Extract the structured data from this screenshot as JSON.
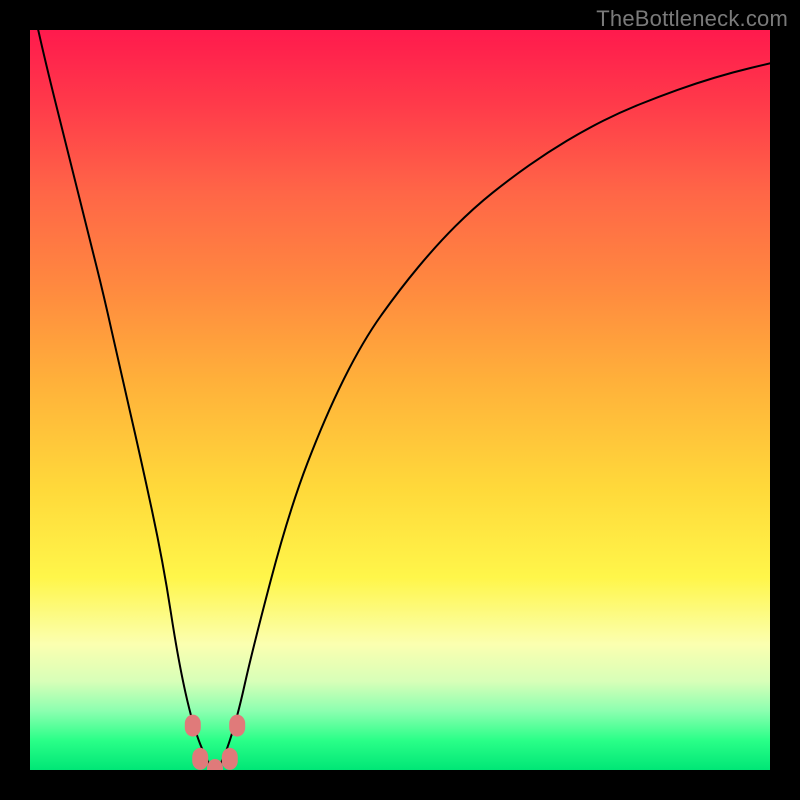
{
  "watermark": "TheBottleneck.com",
  "chart_data": {
    "type": "line",
    "title": "",
    "xlabel": "",
    "ylabel": "",
    "xlim": [
      0,
      100
    ],
    "ylim": [
      0,
      100
    ],
    "x": [
      0,
      2,
      5,
      8,
      10,
      12,
      15,
      18,
      20,
      22,
      24,
      25,
      26,
      28,
      30,
      35,
      40,
      45,
      50,
      55,
      60,
      65,
      70,
      75,
      80,
      85,
      90,
      95,
      100
    ],
    "values": [
      105,
      96,
      84,
      72,
      64,
      55,
      42,
      28,
      15,
      6,
      1,
      0,
      1,
      7,
      16,
      35,
      48,
      58,
      65,
      71,
      76,
      80,
      83.5,
      86.5,
      89,
      91,
      92.8,
      94.3,
      95.5
    ],
    "series": [
      {
        "name": "bottleneck",
        "x_ref": "x",
        "y_ref": "values",
        "color": "#000000"
      }
    ],
    "markers": [
      {
        "x": 22,
        "y": 6,
        "color": "#e07a7a"
      },
      {
        "x": 23,
        "y": 1.5,
        "color": "#e07a7a"
      },
      {
        "x": 25,
        "y": 0,
        "color": "#e07a7a"
      },
      {
        "x": 27,
        "y": 1.5,
        "color": "#e07a7a"
      },
      {
        "x": 28,
        "y": 6,
        "color": "#e07a7a"
      }
    ],
    "annotations": []
  }
}
